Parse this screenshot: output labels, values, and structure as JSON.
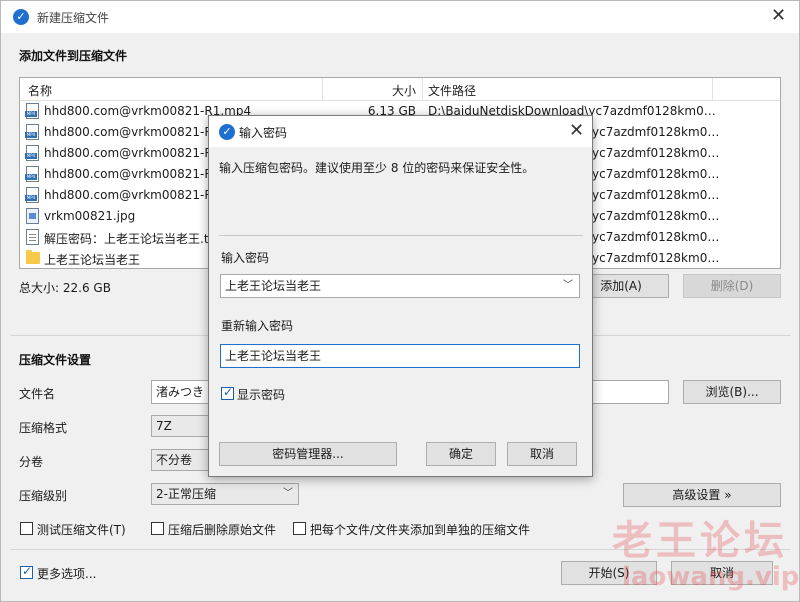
{
  "window": {
    "title": "新建压缩文件",
    "section_add": "添加文件到压缩文件"
  },
  "file_list": {
    "headers": {
      "name": "名称",
      "size": "大小",
      "path": "文件路径"
    },
    "rows": [
      {
        "name": "hhd800.com@vrkm00821-R1.mp4",
        "size": "6.13 GB",
        "path": "D:\\BaiduNetdiskDownload\\yc7azdmf0128km0…",
        "icon": "mp4-file-icon"
      },
      {
        "name": "hhd800.com@vrkm00821-R2",
        "size": "",
        "path": "yc7azdmf0128km0…",
        "icon": "mp4-file-icon"
      },
      {
        "name": "hhd800.com@vrkm00821-R3",
        "size": "",
        "path": "yc7azdmf0128km0…",
        "icon": "mp4-file-icon"
      },
      {
        "name": "hhd800.com@vrkm00821-R4",
        "size": "",
        "path": "yc7azdmf0128km0…",
        "icon": "mp4-file-icon"
      },
      {
        "name": "hhd800.com@vrkm00821-R5",
        "size": "",
        "path": "yc7azdmf0128km0…",
        "icon": "mp4-file-icon"
      },
      {
        "name": "vrkm00821.jpg",
        "size": "",
        "path": "yc7azdmf0128km0…",
        "icon": "image-file-icon"
      },
      {
        "name": "解压密码：上老王论坛当老王.tx",
        "size": "",
        "path": "yc7azdmf0128km0…",
        "icon": "text-file-icon"
      },
      {
        "name": "上老王论坛当老王",
        "size": "",
        "path": "yc7azdmf0128km0…",
        "icon": "folder-icon"
      }
    ]
  },
  "total_size": "总大小: 22.6 GB",
  "buttons": {
    "add": "添加(A)",
    "delete": "删除(D)",
    "browse": "浏览(B)...",
    "advanced": "高级设置 »",
    "start": "开始(S)",
    "cancel": "取消"
  },
  "settings": {
    "title": "压缩文件设置",
    "filename_label": "文件名",
    "filename_value": "渚みつき",
    "format_label": "压缩格式",
    "format_value": "7Z",
    "split_label": "分卷",
    "split_value": "不分卷",
    "level_label": "压缩级别",
    "level_value": "2-正常压缩"
  },
  "options": {
    "test_archive": "测试压缩文件(T)",
    "delete_after": "压缩后删除原始文件",
    "separate_archives": "把每个文件/文件夹添加到单独的压缩文件",
    "more_options": "更多选项..."
  },
  "dialog": {
    "title": "输入密码",
    "hint": "输入压缩包密码。建议使用至少 8 位的密码来保证安全性。",
    "password_label": "输入密码",
    "password_value": "上老王论坛当老王",
    "confirm_label": "重新输入密码",
    "confirm_value": "上老王论坛当老王",
    "show_password": "显示密码",
    "manager_button": "密码管理器...",
    "ok_button": "确定",
    "cancel_button": "取消"
  },
  "watermark": {
    "cn": "老王论坛",
    "url": "laowang.vip"
  },
  "colors": {
    "accent": "#1f6fd1",
    "watermark": "#e63c46"
  }
}
